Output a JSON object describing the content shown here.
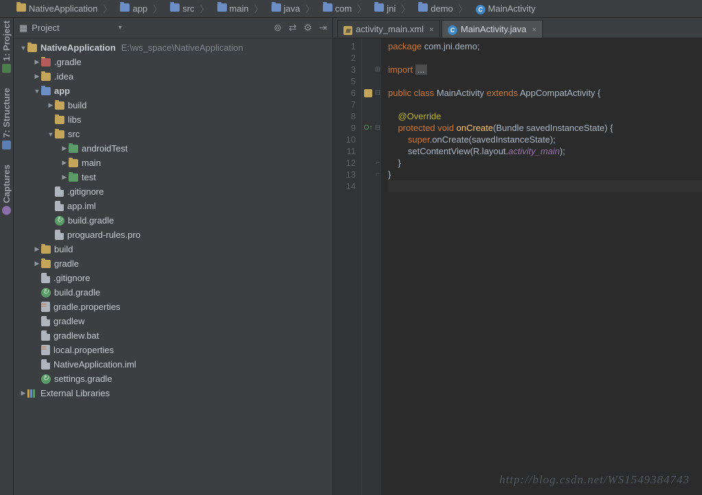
{
  "crumbs": [
    {
      "icon": "folder",
      "label": "NativeApplication"
    },
    {
      "icon": "folder-blue",
      "label": "app"
    },
    {
      "icon": "folder-blue",
      "label": "src"
    },
    {
      "icon": "folder-blue",
      "label": "main"
    },
    {
      "icon": "folder-blue",
      "label": "java"
    },
    {
      "icon": "folder-blue",
      "label": "com"
    },
    {
      "icon": "folder-blue",
      "label": "jni"
    },
    {
      "icon": "folder-blue",
      "label": "demo"
    },
    {
      "icon": "class",
      "label": "MainActivity"
    }
  ],
  "sidebar": {
    "title": "Project",
    "tools": [
      "⊚",
      "⇄",
      "⚙",
      "⇥"
    ],
    "gutter": [
      {
        "label": "1: Project"
      },
      {
        "label": "7: Structure"
      },
      {
        "label": "Captures"
      }
    ]
  },
  "tree": [
    {
      "d": 0,
      "a": "down",
      "ic": "folder",
      "lbl": "NativeApplication",
      "bold": true,
      "path": "E:\\ws_space\\NativeApplication"
    },
    {
      "d": 1,
      "a": "right",
      "ic": "folder-red",
      "lbl": ".gradle"
    },
    {
      "d": 1,
      "a": "right",
      "ic": "folder",
      "lbl": ".idea"
    },
    {
      "d": 1,
      "a": "down",
      "ic": "folder-blue",
      "lbl": "app",
      "bold": true
    },
    {
      "d": 2,
      "a": "right",
      "ic": "folder",
      "lbl": "build"
    },
    {
      "d": 2,
      "a": "none",
      "ic": "folder",
      "lbl": "libs"
    },
    {
      "d": 2,
      "a": "down",
      "ic": "folder",
      "lbl": "src"
    },
    {
      "d": 3,
      "a": "right",
      "ic": "folder-green",
      "lbl": "androidTest"
    },
    {
      "d": 3,
      "a": "right",
      "ic": "folder",
      "lbl": "main"
    },
    {
      "d": 3,
      "a": "right",
      "ic": "folder-green",
      "lbl": "test"
    },
    {
      "d": 2,
      "a": "none",
      "ic": "file",
      "lbl": ".gitignore"
    },
    {
      "d": 2,
      "a": "none",
      "ic": "file",
      "lbl": "app.iml"
    },
    {
      "d": 2,
      "a": "none",
      "ic": "gradle",
      "lbl": "build.gradle"
    },
    {
      "d": 2,
      "a": "none",
      "ic": "file",
      "lbl": "proguard-rules.pro"
    },
    {
      "d": 1,
      "a": "right",
      "ic": "folder",
      "lbl": "build"
    },
    {
      "d": 1,
      "a": "right",
      "ic": "folder",
      "lbl": "gradle"
    },
    {
      "d": 1,
      "a": "none",
      "ic": "file",
      "lbl": ".gitignore"
    },
    {
      "d": 1,
      "a": "none",
      "ic": "gradle",
      "lbl": "build.gradle"
    },
    {
      "d": 1,
      "a": "none",
      "ic": "prop",
      "lbl": "gradle.properties"
    },
    {
      "d": 1,
      "a": "none",
      "ic": "file",
      "lbl": "gradlew"
    },
    {
      "d": 1,
      "a": "none",
      "ic": "file",
      "lbl": "gradlew.bat"
    },
    {
      "d": 1,
      "a": "none",
      "ic": "prop",
      "lbl": "local.properties"
    },
    {
      "d": 1,
      "a": "none",
      "ic": "file",
      "lbl": "NativeApplication.iml"
    },
    {
      "d": 1,
      "a": "none",
      "ic": "gradle",
      "lbl": "settings.gradle"
    },
    {
      "d": 0,
      "a": "right",
      "ic": "lib",
      "lbl": "External Libraries"
    }
  ],
  "tabs": [
    {
      "icon": "xml",
      "label": "activity_main.xml",
      "active": false
    },
    {
      "icon": "class",
      "label": "MainActivity.java",
      "active": true
    }
  ],
  "code": {
    "lines": [
      "1",
      "2",
      "3",
      "5",
      "6",
      "7",
      "8",
      "9",
      "10",
      "11",
      "12",
      "13",
      "14"
    ],
    "tokens": {
      "l1": {
        "kw": "package",
        "pkg": " com.jni.demo;"
      },
      "l3": {
        "kw": "import",
        "box": "..."
      },
      "l6": {
        "kw1": "public",
        "kw2": "class",
        "name": " MainActivity ",
        "kw3": "extends",
        "sup": " AppCompatActivity {"
      },
      "l8": {
        "ann": "@Override"
      },
      "l9": {
        "kw1": "protected",
        "kw2": "void",
        "m": "onCreate",
        "sig": "(Bundle savedInstanceState) {"
      },
      "l10": {
        "kw": "super",
        "rest": ".onCreate(savedInstanceState);"
      },
      "l11": {
        "pre": "setContentView(R.layout.",
        "fld": "activity_main",
        "post": ");"
      },
      "l12": "    }",
      "l13": "}"
    }
  },
  "watermark": "http://blog.csdn.net/WS1549384743"
}
